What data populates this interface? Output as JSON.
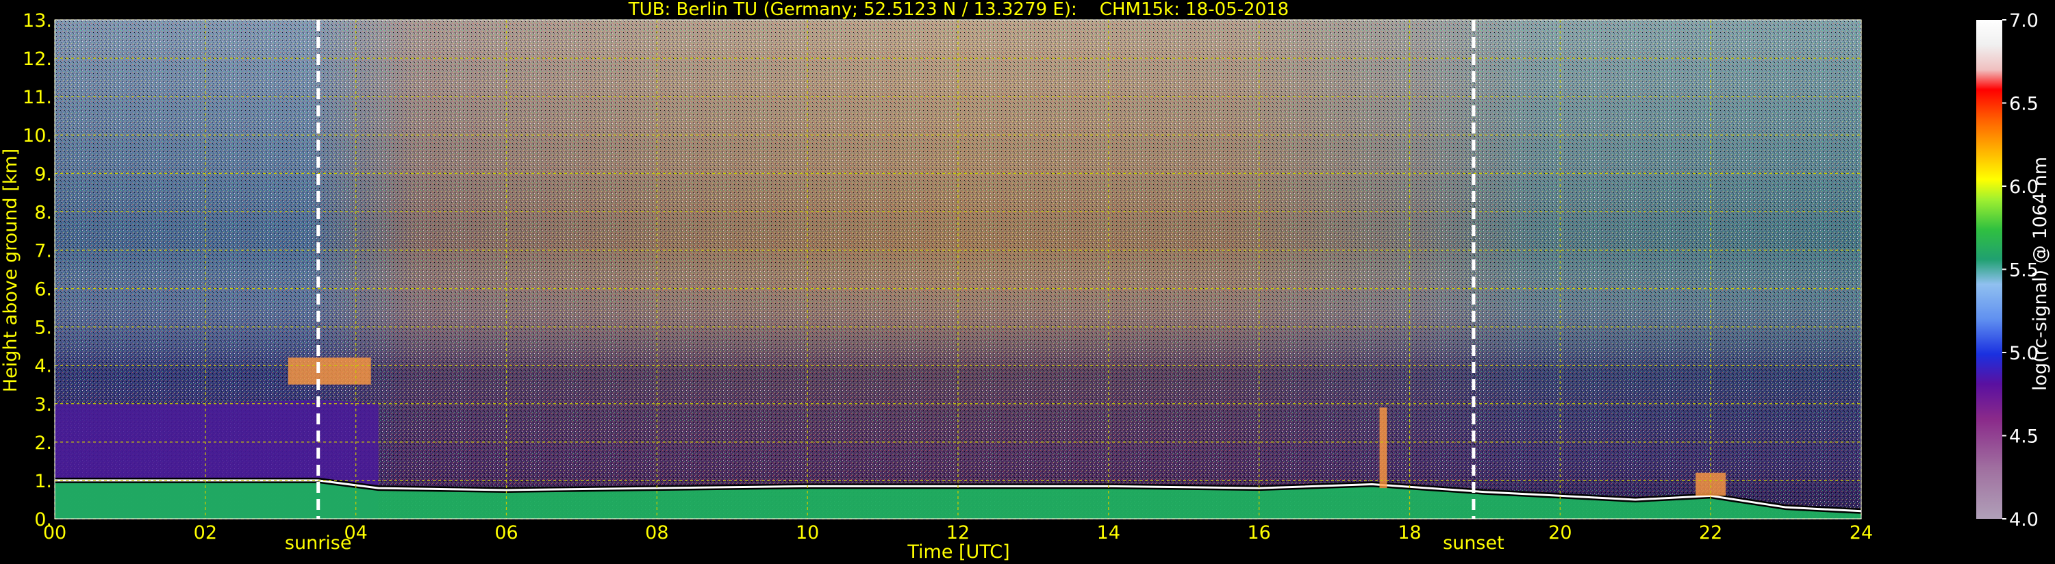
{
  "chart_data": {
    "type": "heatmap",
    "title": "TUB: Berlin TU (Germany; 52.5123 N / 13.3279 E):    CHM15k: 18-05-2018",
    "xlabel": "Time [UTC]",
    "ylabel": "Height above ground [km]",
    "colorbar_label": "log(rc-signal) @ 1064 nm",
    "xlim": [
      0,
      24
    ],
    "ylim": [
      0,
      13
    ],
    "x_ticks": [
      0,
      2,
      4,
      6,
      8,
      10,
      12,
      14,
      16,
      18,
      20,
      22,
      24
    ],
    "x_tick_labels": [
      "00",
      "02",
      "04",
      "06",
      "08",
      "10",
      "12",
      "14",
      "16",
      "18",
      "20",
      "22",
      "24"
    ],
    "y_ticks": [
      0,
      1,
      2,
      3,
      4,
      5,
      6,
      7,
      8,
      9,
      10,
      11,
      12,
      13
    ],
    "y_tick_labels": [
      "0.",
      "1.",
      "2.",
      "3.",
      "4.",
      "5.",
      "6.",
      "7.",
      "8.",
      "9.",
      "10.",
      "11.",
      "12.",
      "13."
    ],
    "colorbar_range": [
      4.0,
      7.0
    ],
    "colorbar_ticks": [
      4.0,
      4.5,
      5.0,
      5.5,
      6.0,
      6.5,
      7.0
    ],
    "colorbar_tick_labels": [
      "4.0",
      "4.5",
      "5.0",
      "5.5",
      "6.0",
      "6.5",
      "7.0"
    ],
    "markers": [
      {
        "label": "sunrise",
        "time": 3.5
      },
      {
        "label": "sunset",
        "time": 18.85
      }
    ],
    "grid": true,
    "colors": {
      "background": "#000000",
      "text": "#ffff00",
      "grid": "#c8c800",
      "marker_line": "#ffffff"
    },
    "aerosol_layer_top_km": [
      {
        "time": 0.0,
        "height": 1.0
      },
      {
        "time": 3.5,
        "height": 1.0
      },
      {
        "time": 4.3,
        "height": 0.8
      },
      {
        "time": 6.0,
        "height": 0.75
      },
      {
        "time": 8.0,
        "height": 0.8
      },
      {
        "time": 10.0,
        "height": 0.85
      },
      {
        "time": 12.0,
        "height": 0.85
      },
      {
        "time": 14.0,
        "height": 0.85
      },
      {
        "time": 16.0,
        "height": 0.8
      },
      {
        "time": 17.5,
        "height": 0.9
      },
      {
        "time": 19.0,
        "height": 0.7
      },
      {
        "time": 21.0,
        "height": 0.5
      },
      {
        "time": 22.0,
        "height": 0.6
      },
      {
        "time": 23.0,
        "height": 0.3
      },
      {
        "time": 24.0,
        "height": 0.2
      }
    ],
    "residual_layer_top_km": [
      {
        "time": 0.0,
        "height": 3.0
      },
      {
        "time": 2.0,
        "height": 3.0
      },
      {
        "time": 3.5,
        "height": 3.1
      },
      {
        "time": 4.3,
        "height": 3.0
      }
    ],
    "cloud_features": [
      {
        "time_start": 3.1,
        "time_end": 4.2,
        "height_bottom": 3.5,
        "height_top": 4.2
      },
      {
        "time_start": 17.6,
        "time_end": 17.7,
        "height_bottom": 0.8,
        "height_top": 2.9
      },
      {
        "time_start": 21.8,
        "time_end": 22.2,
        "height_bottom": 0.6,
        "height_top": 1.2
      }
    ]
  }
}
